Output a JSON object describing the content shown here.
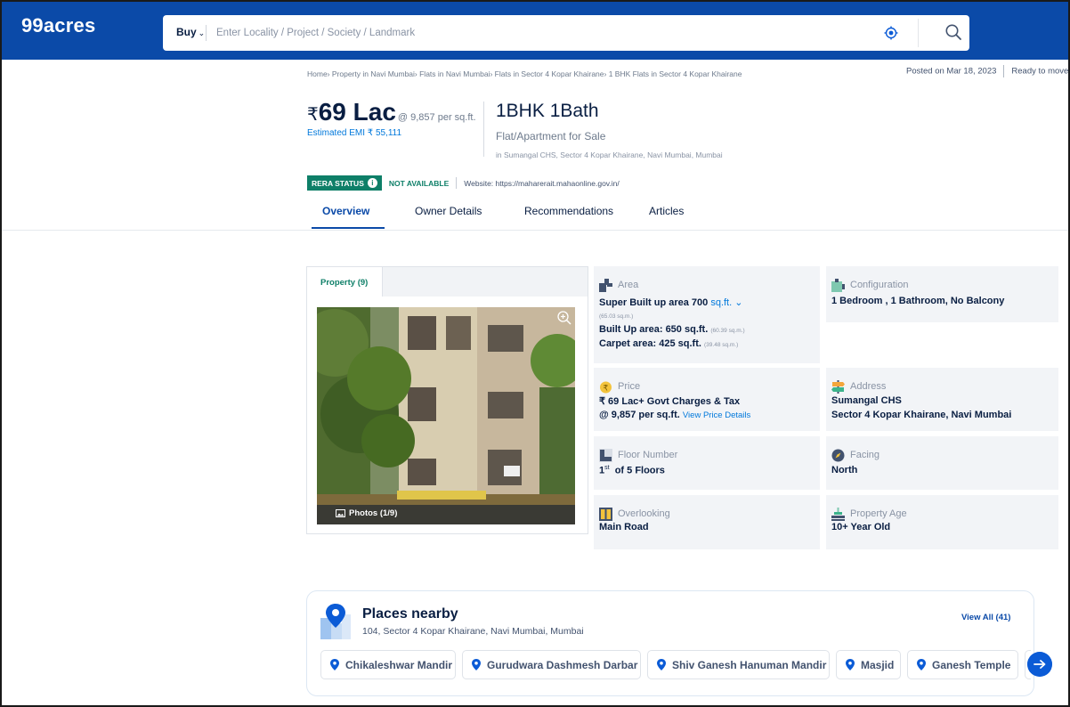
{
  "header": {
    "logo": "99acres",
    "search_type": "Buy",
    "search_placeholder": "Enter Locality / Project / Society / Landmark",
    "brand_color": "#0b4aa8",
    "icons": [
      "chevron-down-icon",
      "location-target-icon",
      "search-icon"
    ]
  },
  "breadcrumb": "Home› Property in Navi Mumbai› Flats in Navi Mumbai› Flats in Sector 4 Kopar Khairane› 1 BHK Flats in Sector 4 Kopar Khairane",
  "meta": {
    "posted": "Posted on Mar 18, 2023",
    "status": "Ready to move"
  },
  "listing": {
    "currency_symbol": "₹",
    "price": "69 Lac",
    "price_per_sqft": "@ 9,857 per sq.ft.",
    "emi": "Estimated EMI ₹ 55,111",
    "config": "1BHK 1Bath",
    "type": "Flat/Apartment for Sale",
    "location": "in Sumangal CHS, Sector 4 Kopar Khairane, Navi Mumbai, Mumbai"
  },
  "rera": {
    "label": "RERA STATUS",
    "status": "NOT AVAILABLE",
    "website": "Website: https://maharerait.mahaonline.gov.in/",
    "status_color": "#0e7f68"
  },
  "tabs": [
    {
      "label": "Overview",
      "active": true
    },
    {
      "label": "Owner Details",
      "active": false
    },
    {
      "label": "Recommendations",
      "active": false
    },
    {
      "label": "Articles",
      "active": false
    }
  ],
  "gallery": {
    "tab_label": "Property (9)",
    "photos_label": "Photos (1/9)"
  },
  "details": {
    "area": {
      "label": "Area",
      "super_built": "Super Built up area 700",
      "super_unit": "sq.ft.",
      "super_sqm": "(65.03 sq.m.)",
      "built_up": "Built Up area: 650 sq.ft.",
      "built_up_sqm": "(60.39 sq.m.)",
      "carpet": "Carpet area: 425 sq.ft.",
      "carpet_sqm": "(39.48 sq.m.)"
    },
    "configuration": {
      "label": "Configuration",
      "value": "1 Bedroom , 1 Bathroom, No Balcony"
    },
    "price": {
      "label": "Price",
      "line1": "₹ 69 Lac+ Govt Charges & Tax",
      "line2": "@ 9,857 per sq.ft.",
      "link": "View Price Details"
    },
    "address": {
      "label": "Address",
      "line1": "Sumangal CHS",
      "line2": "Sector 4 Kopar Khairane, Navi Mumbai"
    },
    "floor": {
      "label": "Floor Number",
      "floor_num": "1",
      "floor_sup": "st",
      "floor_rest": "of 5 Floors"
    },
    "facing": {
      "label": "Facing",
      "value": "North"
    },
    "overlooking": {
      "label": "Overlooking",
      "value": "Main Road"
    },
    "age": {
      "label": "Property Age",
      "value": "10+ Year Old"
    }
  },
  "places": {
    "title": "Places nearby",
    "address": "104, Sector 4 Kopar Khairane, Navi Mumbai, Mumbai",
    "view_all": "View All (41)",
    "chips": [
      "Chikaleshwar Mandir",
      "Gurudwara Dashmesh Darbar",
      "Shiv Ganesh Hanuman Mandir",
      "Masjid",
      "Ganesh Temple"
    ]
  }
}
